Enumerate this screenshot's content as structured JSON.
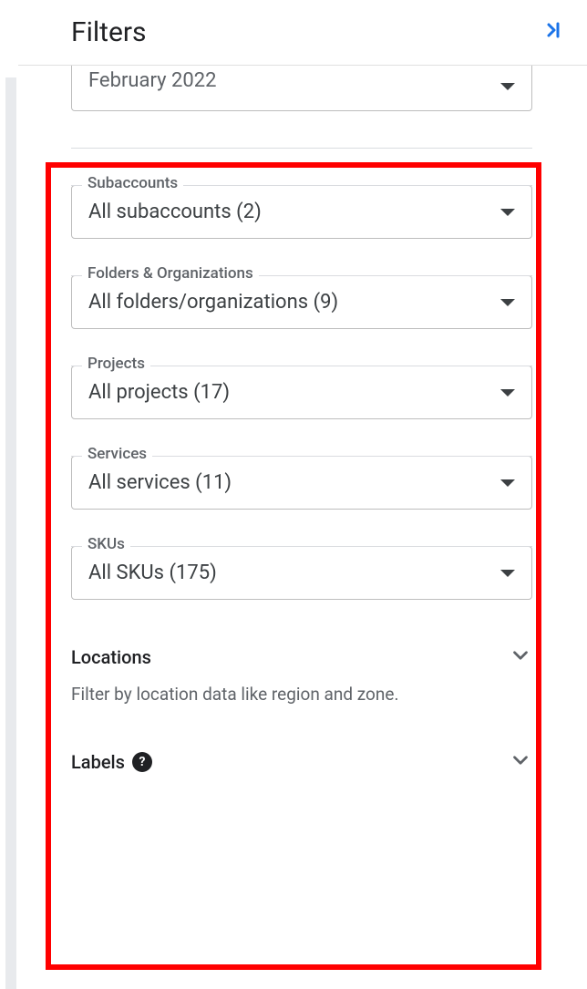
{
  "header": {
    "title": "Filters"
  },
  "partial_select": {
    "value": "February 2022"
  },
  "filters": {
    "subaccounts": {
      "label": "Subaccounts",
      "value": "All subaccounts (2)"
    },
    "folders": {
      "label": "Folders & Organizations",
      "value": "All folders/organizations (9)"
    },
    "projects": {
      "label": "Projects",
      "value": "All projects (17)"
    },
    "services": {
      "label": "Services",
      "value": "All services (11)"
    },
    "skus": {
      "label": "SKUs",
      "value": "All SKUs (175)"
    }
  },
  "expandable": {
    "locations": {
      "title": "Locations",
      "description": "Filter by location data like region and zone."
    },
    "labels": {
      "title": "Labels"
    }
  }
}
